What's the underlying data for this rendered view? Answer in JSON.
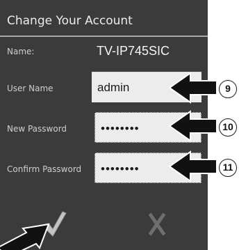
{
  "dialog": {
    "title": "Change Your Account",
    "name_label": "Name:",
    "name_value": "TV-IP745SIC",
    "username_label": "User Name",
    "username_value": "admin",
    "new_password_label": "New Password",
    "new_password_value": "••••••••",
    "confirm_password_label": "Confirm Password",
    "confirm_password_value": "••••••••",
    "confirm_icon": "check-icon",
    "cancel_icon": "close-icon"
  },
  "callouts": {
    "username_number": "9",
    "new_password_number": "10",
    "confirm_password_number": "11"
  },
  "colors": {
    "dialog_background": "#3b3b3b",
    "input_background": "#ececec",
    "title_text": "#ececec",
    "label_text": "#cfcfcf",
    "checkmark": "#c4c4c4",
    "cancel_x": "#6e6e6e"
  }
}
